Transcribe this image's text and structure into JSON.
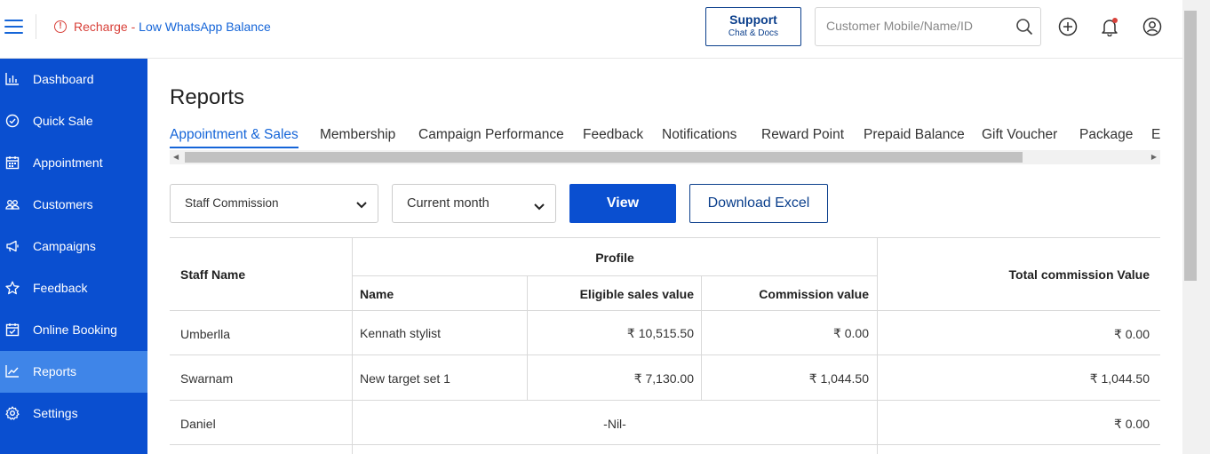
{
  "topbar": {
    "recharge_part1": "Recharge - ",
    "recharge_part2": "Low WhatsApp Balance",
    "support_title": "Support",
    "support_subtitle": "Chat & Docs",
    "search_placeholder": "Customer Mobile/Name/ID"
  },
  "sidebar": {
    "items": [
      {
        "label": "Dashboard",
        "icon": "bar-chart-icon"
      },
      {
        "label": "Quick Sale",
        "icon": "check-circle-icon"
      },
      {
        "label": "Appointment",
        "icon": "calendar-icon"
      },
      {
        "label": "Customers",
        "icon": "users-icon"
      },
      {
        "label": "Campaigns",
        "icon": "megaphone-icon"
      },
      {
        "label": "Feedback",
        "icon": "star-icon"
      },
      {
        "label": "Online Booking",
        "icon": "calendar-check-icon"
      },
      {
        "label": "Reports",
        "icon": "trend-line-icon",
        "active": true
      },
      {
        "label": "Settings",
        "icon": "gear-icon"
      }
    ]
  },
  "main": {
    "title": "Reports",
    "tabs": [
      "Appointment & Sales",
      "Membership",
      "Campaign Performance",
      "Feedback",
      "Notifications",
      "Reward Point",
      "Prepaid Balance",
      "Gift Voucher",
      "Package",
      "Ex"
    ],
    "active_tab": "Appointment & Sales",
    "report_type": "Staff Commission",
    "period": "Current month",
    "view_label": "View",
    "excel_label": "Download Excel"
  },
  "table": {
    "headers": {
      "staff_name": "Staff Name",
      "profile": "Profile",
      "name": "Name",
      "eligible": "Eligible sales value",
      "commission": "Commission value",
      "total": "Total commission Value"
    },
    "rows": [
      {
        "staff": "Umberlla",
        "name": "Kennath stylist",
        "eligible": "₹ 10,515.50",
        "commission": "₹ 0.00",
        "total": "₹ 0.00"
      },
      {
        "staff": "Swarnam",
        "name": "New target set 1",
        "eligible": "₹ 7,130.00",
        "commission": "₹ 1,044.50",
        "total": "₹ 1,044.50"
      },
      {
        "staff": "Daniel",
        "nil": "-Nil-",
        "total": "₹ 0.00"
      }
    ]
  },
  "colors": {
    "sidebar_bg": "#0a4fd0",
    "sidebar_active": "#3f85e8",
    "accent": "#1565d8",
    "warning": "#d8413a"
  }
}
